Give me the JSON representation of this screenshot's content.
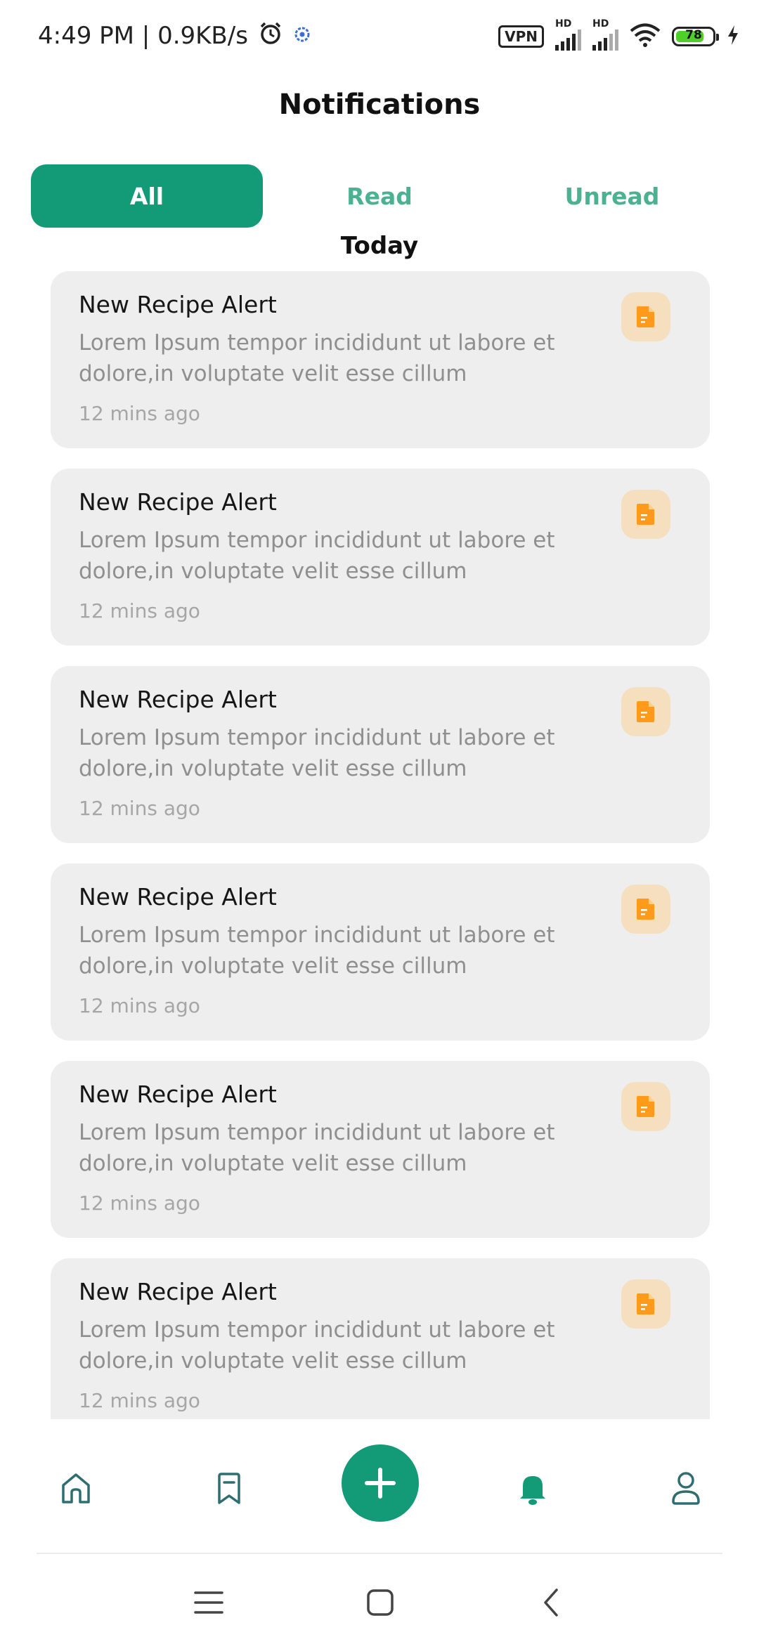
{
  "status_bar": {
    "time_speed": "4:49 PM | 0.9KB/s",
    "vpn_label": "VPN",
    "hd1": "HD",
    "hd2": "HD",
    "battery_level": "78"
  },
  "header": {
    "title": "Notifications"
  },
  "tabs": [
    {
      "label": "All",
      "active": true
    },
    {
      "label": "Read",
      "active": false
    },
    {
      "label": "Unread",
      "active": false
    }
  ],
  "section": {
    "label": "Today"
  },
  "notifications": [
    {
      "title": "New Recipe Alert",
      "body": "Lorem Ipsum tempor incididunt ut labore et dolore,in voluptate velit esse cillum",
      "time": "12 mins ago",
      "icon": "document-icon"
    },
    {
      "title": "New Recipe Alert",
      "body": "Lorem Ipsum tempor incididunt ut labore et dolore,in voluptate velit esse cillum",
      "time": "12 mins ago",
      "icon": "document-icon"
    },
    {
      "title": "New Recipe Alert",
      "body": "Lorem Ipsum tempor incididunt ut labore et dolore,in voluptate velit esse cillum",
      "time": "12 mins ago",
      "icon": "document-icon"
    },
    {
      "title": "New Recipe Alert",
      "body": "Lorem Ipsum tempor incididunt ut labore et dolore,in voluptate velit esse cillum",
      "time": "12 mins ago",
      "icon": "document-icon"
    },
    {
      "title": "New Recipe Alert",
      "body": "Lorem Ipsum tempor incididunt ut labore et dolore,in voluptate velit esse cillum",
      "time": "12 mins ago",
      "icon": "document-icon"
    },
    {
      "title": "New Recipe Alert",
      "body": "Lorem Ipsum tempor incididunt ut labore et dolore,in voluptate velit esse cillum",
      "time": "12 mins ago",
      "icon": "document-icon"
    }
  ],
  "bottom_nav": {
    "items": [
      "home-icon",
      "bookmark-icon",
      "plus-icon",
      "bell-icon",
      "profile-icon"
    ],
    "active": "bell-icon"
  },
  "colors": {
    "accent": "#139a77",
    "tab_inactive": "#4bb190",
    "card_bg": "#eeeeee",
    "icon_bg": "#f6dfbf",
    "icon_fg": "#ff9a1a"
  }
}
